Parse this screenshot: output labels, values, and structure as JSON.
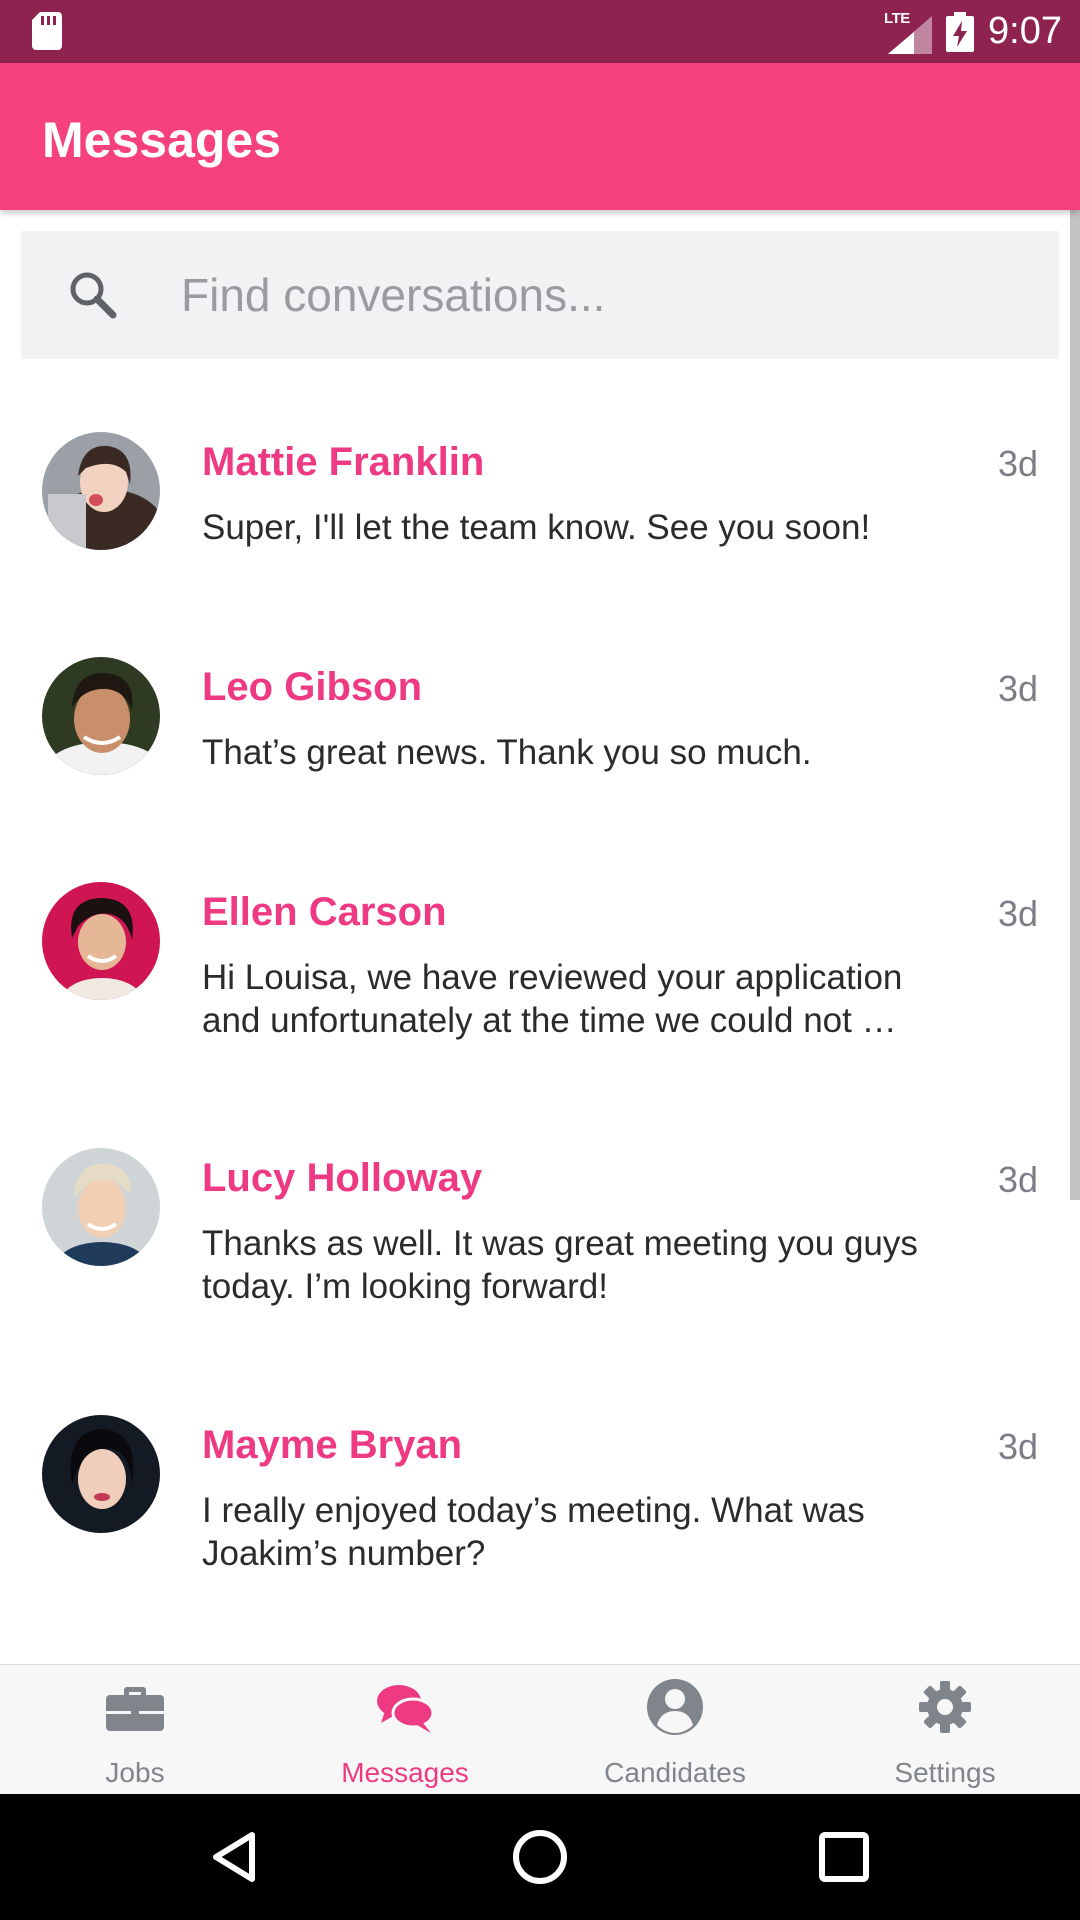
{
  "status_bar": {
    "time": "9:07",
    "network_label": "LTE",
    "icons": [
      "sd-card-icon",
      "signal-icon",
      "battery-charging-icon"
    ]
  },
  "app_bar": {
    "title": "Messages"
  },
  "search": {
    "placeholder": "Find conversations...",
    "value": "",
    "icon": "search-icon"
  },
  "conversations": [
    {
      "name": "Mattie Franklin",
      "time": "3d",
      "preview": "Super, I'll let the team know. See you soon!"
    },
    {
      "name": "Leo Gibson",
      "time": "3d",
      "preview": "That’s great news. Thank you so much."
    },
    {
      "name": "Ellen Carson",
      "time": "3d",
      "preview": "Hi Louisa, we have reviewed your application and unfortunately at the time we could not …"
    },
    {
      "name": "Lucy Holloway",
      "time": "3d",
      "preview": "Thanks as well. It was great meeting you guys today. I’m looking forward!"
    },
    {
      "name": "Mayme Bryan",
      "time": "3d",
      "preview": "I really enjoyed today’s meeting. What was Joakim’s number?"
    }
  ],
  "bottom_nav": {
    "items": [
      {
        "label": "Jobs",
        "icon": "briefcase-icon",
        "active": false
      },
      {
        "label": "Messages",
        "icon": "chat-icon",
        "active": true
      },
      {
        "label": "Candidates",
        "icon": "person-icon",
        "active": false
      },
      {
        "label": "Settings",
        "icon": "gear-icon",
        "active": false
      }
    ]
  },
  "system_nav": {
    "icons": [
      "back-icon",
      "home-icon",
      "recents-icon"
    ]
  },
  "colors": {
    "status_bar": "#8e2350",
    "accent": "#f7417f",
    "name_text": "#ee3a82",
    "inactive_nav": "#80858b"
  }
}
